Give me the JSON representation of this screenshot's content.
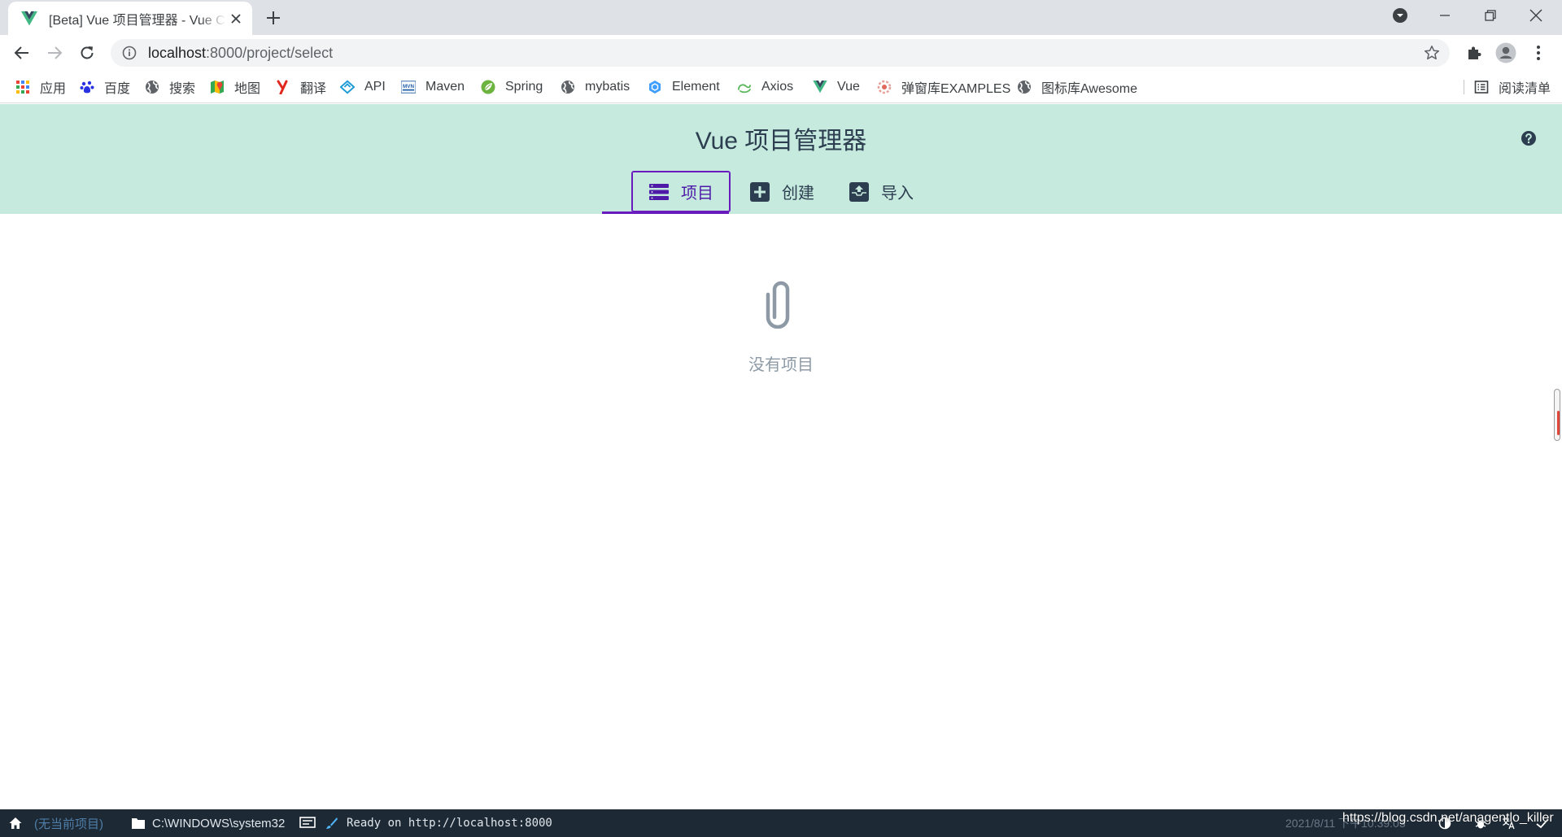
{
  "browser": {
    "tab_title": "[Beta] Vue 项目管理器 - Vue CLI",
    "url_host": "localhost",
    "url_path": ":8000/project/select"
  },
  "bookmarks": [
    {
      "label": "应用",
      "icon": "apps-grid-icon"
    },
    {
      "label": "百度",
      "icon": "baidu-paw-icon"
    },
    {
      "label": "搜索",
      "icon": "globe-icon"
    },
    {
      "label": "地图",
      "icon": "maps-icon"
    },
    {
      "label": "翻译",
      "icon": "youdao-icon"
    },
    {
      "label": "API",
      "icon": "api-icon"
    },
    {
      "label": "Maven",
      "icon": "maven-icon"
    },
    {
      "label": "Spring",
      "icon": "spring-leaf-icon"
    },
    {
      "label": "mybatis",
      "icon": "globe-icon"
    },
    {
      "label": "Element",
      "icon": "element-cube-icon"
    },
    {
      "label": "Axios",
      "icon": "axios-icon"
    },
    {
      "label": "Vue",
      "icon": "vue-logo-icon"
    },
    {
      "label": "弹窗库EXAMPLES",
      "icon": "popup-lib-icon"
    },
    {
      "label": "图标库Awesome",
      "icon": "globe-icon"
    }
  ],
  "reading_list": "阅读清单",
  "app": {
    "title": "Vue 项目管理器",
    "tabs": [
      {
        "label": "项目",
        "icon": "list-icon",
        "active": true
      },
      {
        "label": "创建",
        "icon": "plus-box-icon",
        "active": false
      },
      {
        "label": "导入",
        "icon": "import-box-icon",
        "active": false
      }
    ],
    "empty_text": "没有项目"
  },
  "statusbar": {
    "no_project": "(无当前项目)",
    "cwd": "C:\\WINDOWS\\system32",
    "log": "Ready on http://localhost:8000",
    "datetime": "2021/8/11 下午10:39:03",
    "watermark": "https://blog.csdn.net/anagentlo_killer"
  },
  "colors": {
    "header_bg": "#c6eade",
    "accent": "#6a1bbd",
    "statusbar_bg": "#1d2935"
  }
}
